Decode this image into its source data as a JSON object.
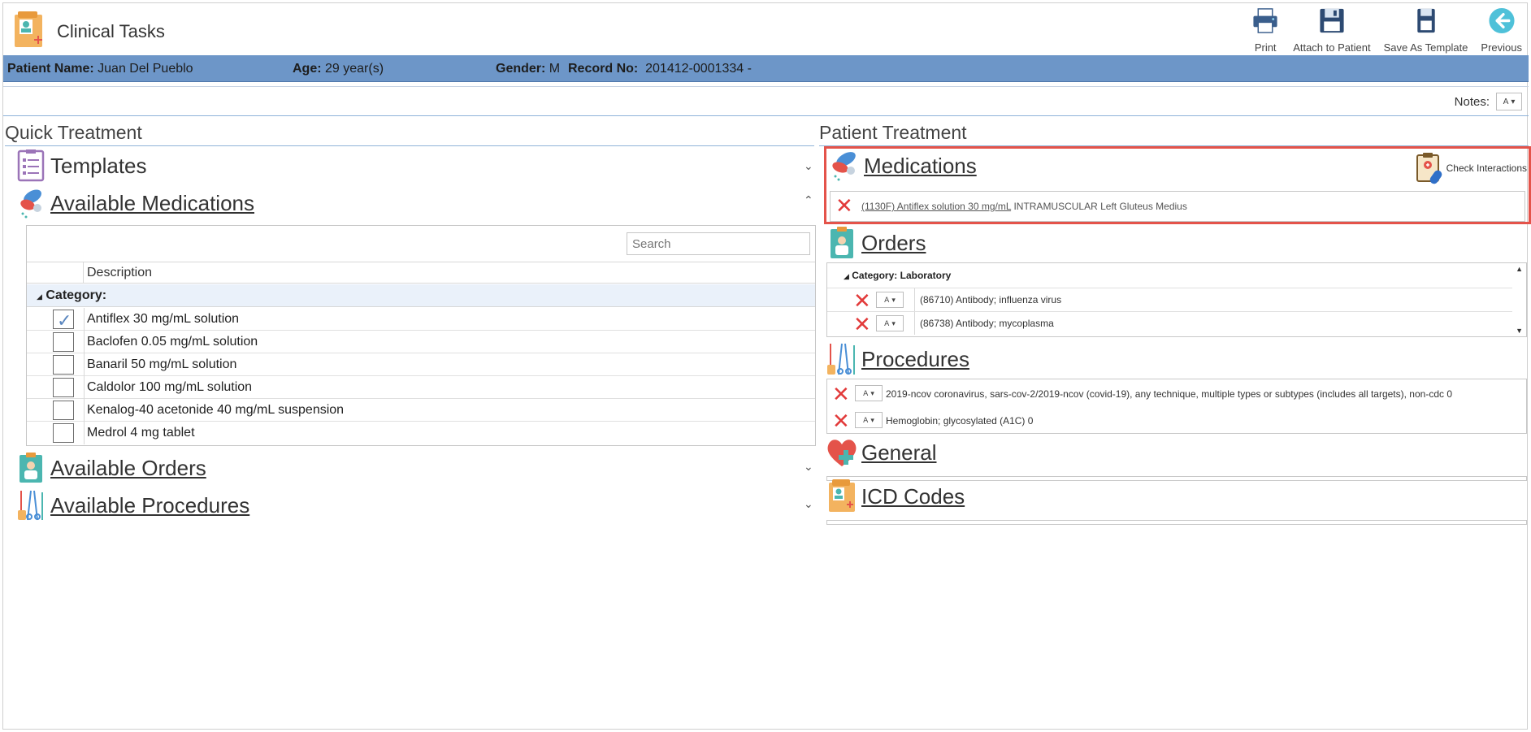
{
  "app": {
    "title": "Clinical Tasks"
  },
  "toolbar": {
    "print": "Print",
    "attach": "Attach to Patient",
    "save_template": "Save As Template",
    "previous": "Previous"
  },
  "patient": {
    "name_label": "Patient Name:",
    "name": "Juan Del Pueblo",
    "age_label": "Age:",
    "age": "29 year(s)",
    "gender_label": "Gender:",
    "gender": "M",
    "record_label": "Record No:",
    "record": "201412-0001334 -"
  },
  "notes": {
    "label": "Notes:"
  },
  "quick_treatment": {
    "title": "Quick Treatment",
    "templates": "Templates",
    "available_medications": "Available Medications",
    "available_orders": "Available Orders",
    "available_procedures": "Available Procedures",
    "search_placeholder": "Search",
    "grid_header": "Description",
    "category_label": "Category:",
    "medications": [
      {
        "name": "Antiflex 30 mg/mL solution",
        "checked": true
      },
      {
        "name": "Baclofen 0.05 mg/mL solution",
        "checked": false
      },
      {
        "name": "Banaril 50 mg/mL solution",
        "checked": false
      },
      {
        "name": "Caldolor 100 mg/mL solution",
        "checked": false
      },
      {
        "name": "Kenalog-40 acetonide 40 mg/mL suspension",
        "checked": false
      },
      {
        "name": "Medrol 4 mg tablet",
        "checked": false
      }
    ]
  },
  "patient_treatment": {
    "title": "Patient Treatment",
    "medications": "Medications",
    "check_interactions": "Check Interactions",
    "med_entry_link": "(1130F) Antiflex solution 30 mg/mL",
    "med_entry_detail": "INTRAMUSCULAR Left Gluteus Medius",
    "orders": "Orders",
    "orders_category": "Category: Laboratory",
    "order_items": [
      "(86710) Antibody; influenza virus",
      "(86738) Antibody; mycoplasma"
    ],
    "procedures": "Procedures",
    "procedure_items": [
      "2019-ncov coronavirus, sars-cov-2/2019-ncov (covid-19), any technique, multiple types or subtypes (includes all targets), non-cdc 0",
      "Hemoglobin; glycosylated (A1C) 0"
    ],
    "general": "General",
    "icd_codes": "ICD Codes"
  }
}
